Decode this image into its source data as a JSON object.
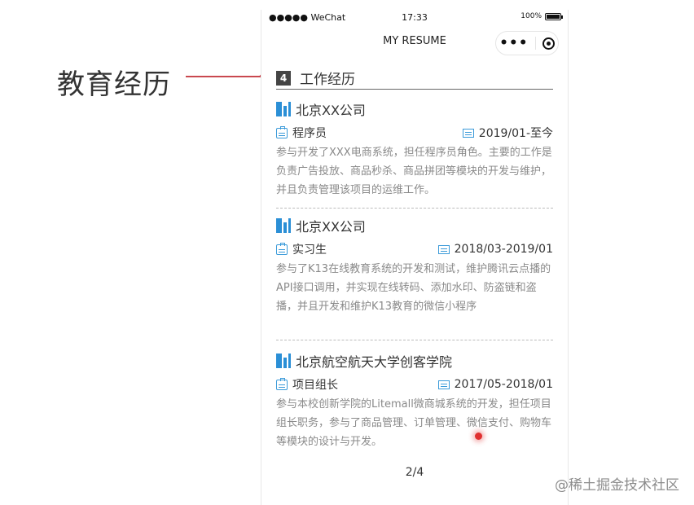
{
  "callout": {
    "label": "教育经历",
    "line_color": "#c9484f"
  },
  "status_bar": {
    "carrier": "●●●●● WeChat",
    "time": "17:33",
    "battery": "100%"
  },
  "nav": {
    "title": "MY RESUME",
    "more_icon": "•••",
    "icons": [
      "more-icon",
      "target-icon"
    ]
  },
  "section": {
    "number": "4",
    "title": "工作经历"
  },
  "entries": [
    {
      "company": "北京XX公司",
      "role": "程序员",
      "date": "2019/01-至今",
      "desc": "参与开发了XXX电商系统，担任程序员角色。主要的工作是负责广告投放、商品秒杀、商品拼团等模块的开发与维护，并且负责管理该项目的运维工作。"
    },
    {
      "company": "北京XX公司",
      "role": "实习生",
      "date": "2018/03-2019/01",
      "desc": "参与了K13在线教育系统的开发和测试，维护腾讯云点播的API接口调用，并实现在线转码、添加水印、防盗链和盗播，并且开发和维护K13教育的微信小程序"
    },
    {
      "company": "北京航空航天大学创客学院",
      "role": "项目组长",
      "date": "2017/05-2018/01",
      "desc": "参与本校创新学院的Litemall微商城系统的开发，担任项目组长职务，参与了商品管理、订单管理、微信支付、购物车等模块的设计与开发。"
    }
  ],
  "pagination": {
    "label": "2/4"
  },
  "watermark": "@稀土掘金技术社区",
  "colors": {
    "accent_blue": "#2b8fd6",
    "section_badge": "#444444",
    "desc_text": "#8a8a8a"
  }
}
